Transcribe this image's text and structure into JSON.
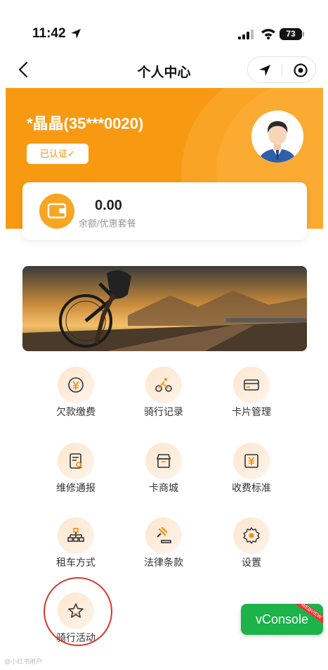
{
  "status_bar": {
    "time": "11:42",
    "battery": "73"
  },
  "nav": {
    "title": "个人中心"
  },
  "profile": {
    "username": "*晶晶(35***0020)",
    "verified_label": "已认证✓"
  },
  "wallet": {
    "balance": "0.00",
    "label": "余额/优惠套餐"
  },
  "menu": [
    {
      "label": "欠款缴费",
      "icon": "debt-payment-icon"
    },
    {
      "label": "骑行记录",
      "icon": "cyclist-icon"
    },
    {
      "label": "卡片管理",
      "icon": "card-icon"
    },
    {
      "label": "维修通报",
      "icon": "repair-report-icon"
    },
    {
      "label": "卡商城",
      "icon": "shop-icon"
    },
    {
      "label": "收费标准",
      "icon": "pricing-icon"
    },
    {
      "label": "租车方式",
      "icon": "org-chart-icon"
    },
    {
      "label": "法律条款",
      "icon": "gavel-icon"
    },
    {
      "label": "设置",
      "icon": "gear-icon"
    },
    {
      "label": "骑行活动",
      "icon": "star-icon"
    }
  ],
  "vconsole": {
    "label": "vConsole",
    "tag": "WEBVIEW"
  },
  "watermark": "@小红书用户",
  "colors": {
    "accent": "#f79a12",
    "highlight": "#d9342b",
    "vconsole": "#1cb34a"
  }
}
